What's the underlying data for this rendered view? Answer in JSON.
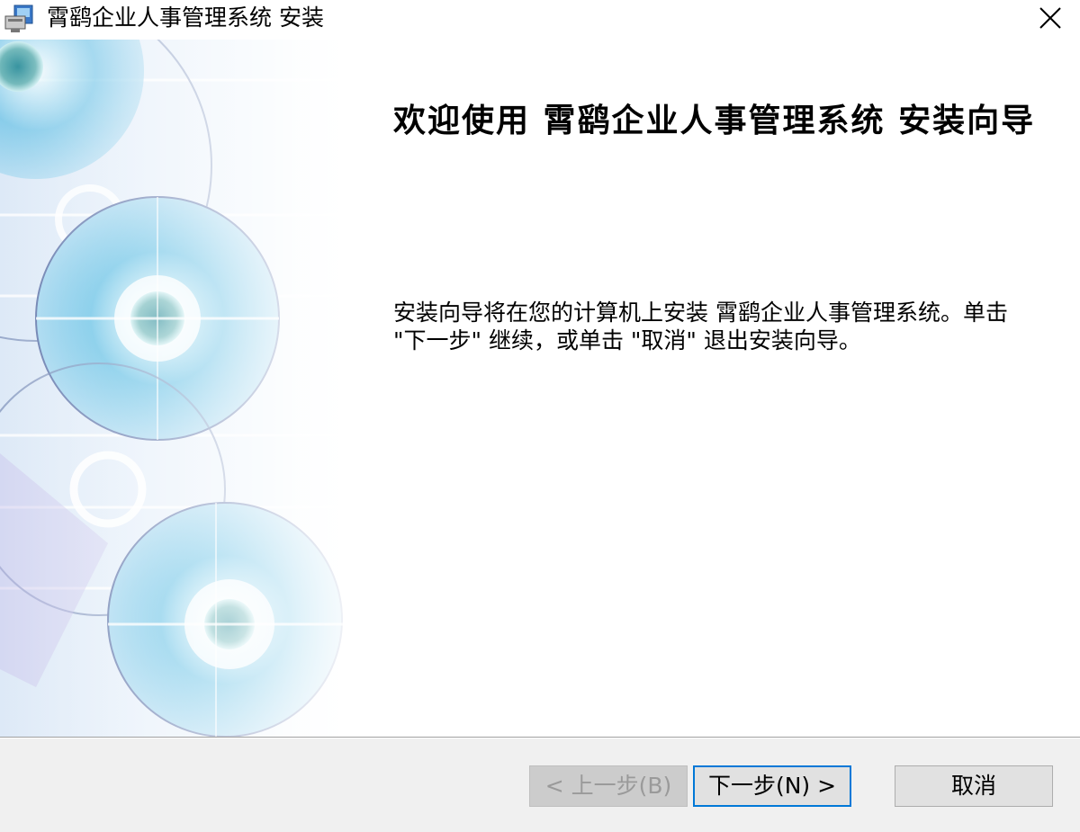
{
  "window": {
    "title": "霄鹞企业人事管理系统 安装"
  },
  "content": {
    "heading": "欢迎使用 霄鹞企业人事管理系统 安装向导",
    "description": "安装向导将在您的计算机上安装 霄鹞企业人事管理系统。单击 \"下一步\" 继续，或单击 \"取消\" 退出安装向导。"
  },
  "buttons": {
    "back_label": "< 上一步(B)",
    "next_label": "下一步(N) >",
    "cancel_label": "取消"
  },
  "icons": {
    "app": "installer-app-icon",
    "close": "close-icon"
  },
  "colors": {
    "focus_border": "#0078d7",
    "footer_bg": "#f0f0f0",
    "banner_accent": "#5ab8e0"
  }
}
